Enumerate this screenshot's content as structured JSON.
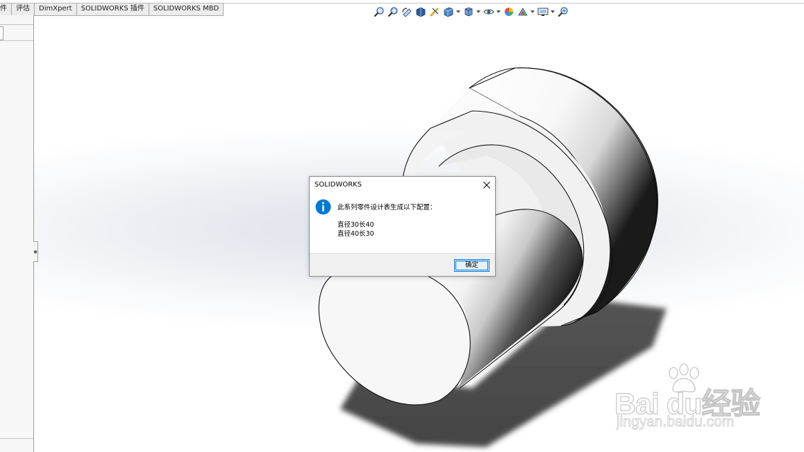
{
  "tabs": [
    {
      "label": "件"
    },
    {
      "label": "评估"
    },
    {
      "label": "DimXpert"
    },
    {
      "label": "SOLIDWORKS 插件"
    },
    {
      "label": "SOLIDWORKS MBD"
    }
  ],
  "hud_icons": [
    "zoom-to-fit-icon",
    "zoom-to-area-icon",
    "previous-view-icon",
    "section-view-icon",
    "dynamic-annotation-icon",
    "view-orientation-icon",
    "display-style-icon",
    "hide-show-items-icon",
    "edit-appearance-icon",
    "apply-scene-icon",
    "view-settings-icon",
    "zoom-icon"
  ],
  "dialog": {
    "title": "SOLIDWORKS",
    "message": "此系列零件设计表生成以下配置：",
    "configs": [
      "直径30长40",
      "直径40长30"
    ],
    "ok_label": "确定",
    "accent": "#0078d7"
  },
  "watermark": {
    "brand": "Bai du经验",
    "url": "jingyan.baidu.com"
  }
}
